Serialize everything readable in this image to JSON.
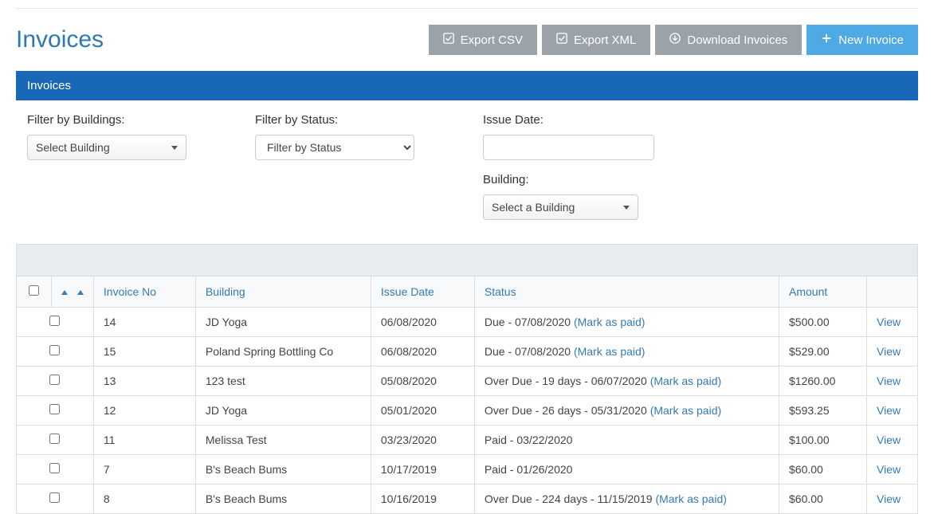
{
  "page": {
    "title": "Invoices",
    "panel_title": "Invoices"
  },
  "toolbar": {
    "export_csv_label": "Export CSV",
    "export_xml_label": "Export XML",
    "download_label": "Download Invoices",
    "new_invoice_label": "New Invoice"
  },
  "filters": {
    "buildings_label": "Filter by Buildings:",
    "buildings_value": "Select Building",
    "status_label": "Filter by Status:",
    "status_value": "Filter by Status",
    "issue_date_label": "Issue Date:",
    "issue_date_value": "",
    "building_label": "Building:",
    "building_value": "Select a Building"
  },
  "table": {
    "col_invoice": "Invoice No",
    "col_building": "Building",
    "col_issue": "Issue Date",
    "col_status": "Status",
    "col_amount": "Amount",
    "mark_paid": "(Mark as paid)",
    "view_label": "View",
    "rows": [
      {
        "invoice_no": "14",
        "building": "JD Yoga",
        "issue_date": "06/08/2020",
        "status": "Due - 07/08/2020 ",
        "mark": true,
        "amount": "$500.00"
      },
      {
        "invoice_no": "15",
        "building": "Poland Spring Bottling Co",
        "issue_date": "06/08/2020",
        "status": "Due - 07/08/2020 ",
        "mark": true,
        "amount": "$529.00"
      },
      {
        "invoice_no": "13",
        "building": "123 test",
        "issue_date": "05/08/2020",
        "status": "Over Due - 19 days - 06/07/2020 ",
        "mark": true,
        "amount": "$1260.00"
      },
      {
        "invoice_no": "12",
        "building": "JD Yoga",
        "issue_date": "05/01/2020",
        "status": "Over Due - 26 days - 05/31/2020 ",
        "mark": true,
        "amount": "$593.25"
      },
      {
        "invoice_no": "11",
        "building": "Melissa Test",
        "issue_date": "03/23/2020",
        "status": "Paid - 03/22/2020",
        "mark": false,
        "amount": "$100.00"
      },
      {
        "invoice_no": "7",
        "building": "B's Beach Bums",
        "issue_date": "10/17/2019",
        "status": "Paid - 01/26/2020",
        "mark": false,
        "amount": "$60.00"
      },
      {
        "invoice_no": "8",
        "building": "B's Beach Bums",
        "issue_date": "10/16/2019",
        "status": "Over Due - 224 days - 11/15/2019 ",
        "mark": true,
        "amount": "$60.00"
      }
    ]
  }
}
